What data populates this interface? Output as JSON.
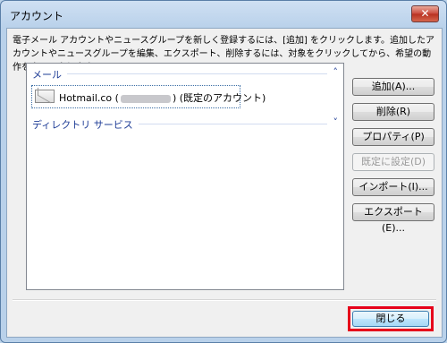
{
  "window": {
    "title": "アカウント",
    "close_glyph": "✕"
  },
  "instructions": "電子メール アカウントやニュースグループを新しく登録するには、[追加] をクリックします。追加したアカウントやニュースグループを編集、エクスポート、削除するには、対象をクリックしてから、希望の動作をクリックします。",
  "list": {
    "groups": [
      {
        "label": "メール",
        "chevron": "˄"
      },
      {
        "label": "ディレクトリ サービス",
        "chevron": "˅"
      }
    ],
    "account": {
      "name_prefix": "Hotmail.co",
      "suffix": "(既定のアカウント)"
    }
  },
  "buttons": [
    {
      "label": "追加(A)...",
      "enabled": true
    },
    {
      "label": "削除(R)",
      "enabled": true
    },
    {
      "label": "プロパティ(P)",
      "enabled": true
    },
    {
      "label": "既定に設定(D)",
      "enabled": false
    },
    {
      "label": "インポート(I)...",
      "enabled": true
    },
    {
      "label": "エクスポート(E)...",
      "enabled": true
    }
  ],
  "close_button": {
    "label": "閉じる"
  },
  "colors": {
    "highlight": "#e6001a",
    "group_text": "#1e3c96"
  }
}
